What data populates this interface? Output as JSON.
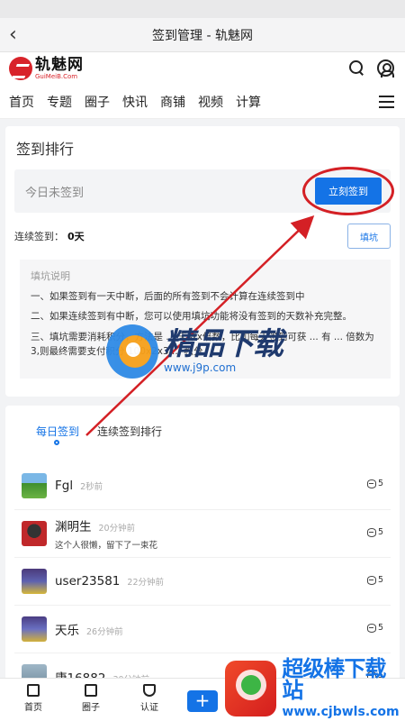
{
  "titlebar": {
    "back_icon": "chevron-left-icon",
    "title": "签到管理 - 轨魅网"
  },
  "header": {
    "logo_cn": "轨魅网",
    "logo_en": "GuiMeiB.Com",
    "icons": [
      "search-icon",
      "user-icon"
    ]
  },
  "nav": {
    "items": [
      "首页",
      "专题",
      "圈子",
      "快讯",
      "商铺",
      "视频",
      "计算"
    ],
    "menu_icon": "hamburger-icon"
  },
  "checkin": {
    "section_title": "签到排行",
    "status_text": "今日未签到",
    "button_label": "立刻签到",
    "streak_label": "连续签到：",
    "streak_value": "0天",
    "fill_button_label": "填坑",
    "note_title": "填坑说明",
    "notes": [
      "一、如果签到有一天中断，后面的所有签到不会计算在连续签到中",
      "二、如果连续签到有中断，您可以使用填坑功能将没有签到的天数补充完整。",
      "三、填坑需要消耗积分，方法是 ... 天数x倍数，比如每天签到可获 ... 有 ... 倍数为3,则最终需要支付积分 100x2x3 ... 积分。"
    ]
  },
  "records": {
    "tabs": [
      "每日签到",
      "连续签到排行"
    ],
    "active_tab": 0,
    "items": [
      {
        "name": "Fgl",
        "time": "2秒前",
        "message": "",
        "coins": "5"
      },
      {
        "name": "渊明生",
        "time": "20分钟前",
        "message": "这个人很懒，留下了一束花",
        "coins": "5"
      },
      {
        "name": "user23581",
        "time": "22分钟前",
        "message": "",
        "coins": "5"
      },
      {
        "name": "天乐",
        "time": "26分钟前",
        "message": "",
        "coins": "5"
      },
      {
        "name": "康16882",
        "time": "30分钟前",
        "message": "",
        "coins": "5"
      }
    ]
  },
  "bottombar": {
    "items": [
      {
        "label": "首页",
        "icon": "home-icon"
      },
      {
        "label": "圈子",
        "icon": "bookmark-icon"
      },
      {
        "label": "认证",
        "icon": "shield-icon"
      }
    ],
    "plus_label": "+"
  },
  "watermarks": {
    "center": {
      "text": "精品下载",
      "url": "www.j9p.com"
    },
    "corner": {
      "text": "超级棒下载站",
      "url": "www.cjbwls.com"
    }
  },
  "colors": {
    "accent": "#1473e6",
    "annotation": "#d42025"
  }
}
